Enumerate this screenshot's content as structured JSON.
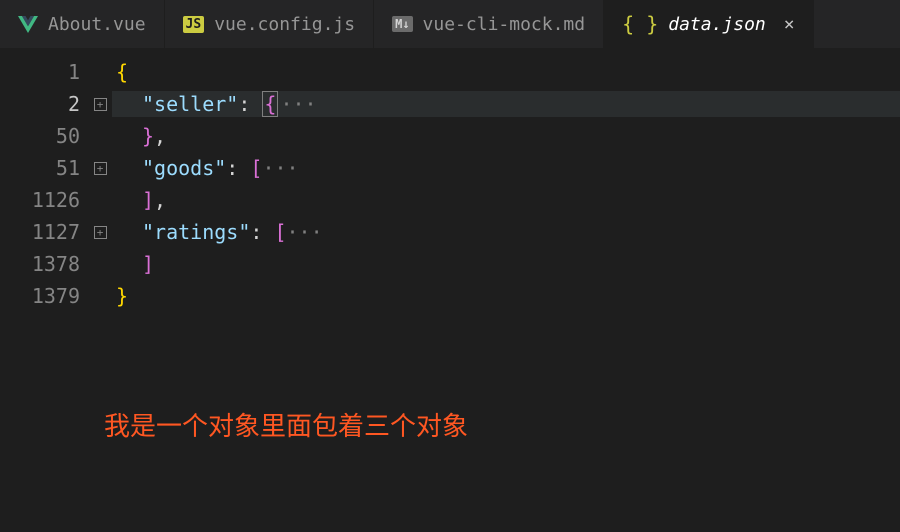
{
  "tabs": [
    {
      "icon": "vue",
      "label": "About.vue",
      "active": false
    },
    {
      "icon": "js",
      "iconText": "JS",
      "label": "vue.config.js",
      "active": false
    },
    {
      "icon": "md",
      "iconText": "M↓",
      "label": "vue-cli-mock.md",
      "active": false
    },
    {
      "icon": "json",
      "iconText": "{ }",
      "label": "data.json",
      "active": true,
      "closable": true
    }
  ],
  "closeGlyph": "×",
  "foldGlyph": "+",
  "ellipsis": "···",
  "lines": [
    {
      "num": "1",
      "fold": false,
      "indent": 0,
      "tokens": [
        {
          "t": "{",
          "c": "brace"
        }
      ]
    },
    {
      "num": "2",
      "fold": true,
      "current": true,
      "indent": 1,
      "tokens": [
        {
          "t": "\"seller\"",
          "c": "key"
        },
        {
          "t": ": ",
          "c": "punc"
        },
        {
          "t": "{",
          "c": "brace-purple",
          "boxed": true
        },
        {
          "t": "···",
          "c": "fold"
        }
      ]
    },
    {
      "num": "50",
      "fold": false,
      "indent": 1,
      "tokens": [
        {
          "t": "}",
          "c": "brace-purple"
        },
        {
          "t": ",",
          "c": "punc"
        }
      ]
    },
    {
      "num": "51",
      "fold": true,
      "indent": 1,
      "tokens": [
        {
          "t": "\"goods\"",
          "c": "key"
        },
        {
          "t": ": ",
          "c": "punc"
        },
        {
          "t": "[",
          "c": "brace-purple"
        },
        {
          "t": "···",
          "c": "fold"
        }
      ]
    },
    {
      "num": "1126",
      "fold": false,
      "indent": 1,
      "tokens": [
        {
          "t": "]",
          "c": "brace-purple"
        },
        {
          "t": ",",
          "c": "punc"
        }
      ]
    },
    {
      "num": "1127",
      "fold": true,
      "indent": 1,
      "tokens": [
        {
          "t": "\"ratings\"",
          "c": "key"
        },
        {
          "t": ": ",
          "c": "punc"
        },
        {
          "t": "[",
          "c": "brace-purple"
        },
        {
          "t": "···",
          "c": "fold"
        }
      ]
    },
    {
      "num": "1378",
      "fold": false,
      "indent": 1,
      "tokens": [
        {
          "t": "]",
          "c": "brace-purple"
        }
      ]
    },
    {
      "num": "1379",
      "fold": false,
      "indent": 0,
      "tokens": [
        {
          "t": "}",
          "c": "brace"
        }
      ]
    }
  ],
  "annotation": "我是一个对象里面包着三个对象"
}
